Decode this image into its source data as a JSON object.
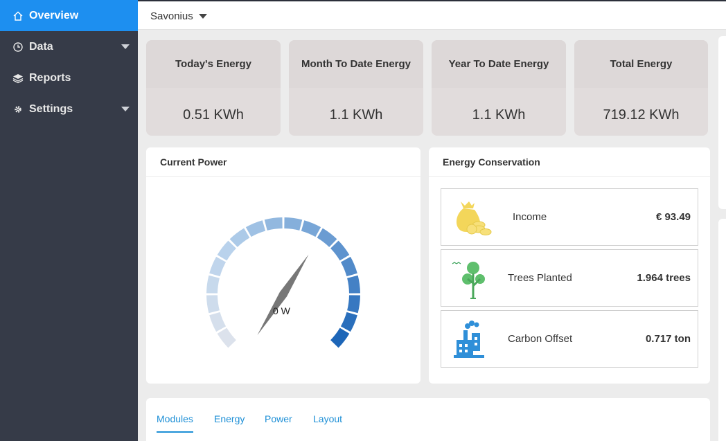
{
  "sidebar": {
    "items": [
      {
        "label": "Overview",
        "icon": "home-icon"
      },
      {
        "label": "Data",
        "icon": "clock-icon"
      },
      {
        "label": "Reports",
        "icon": "layers-icon"
      },
      {
        "label": "Settings",
        "icon": "gear-icon"
      }
    ]
  },
  "topbar": {
    "site": "Savonius"
  },
  "stats": [
    {
      "title": "Today's Energy",
      "value": "0.51 KWh"
    },
    {
      "title": "Month To Date Energy",
      "value": "1.1 KWh"
    },
    {
      "title": "Year To Date Energy",
      "value": "1.1 KWh"
    },
    {
      "title": "Total Energy",
      "value": "719.12 KWh"
    }
  ],
  "current_power": {
    "title": "Current Power",
    "readout": "0 W",
    "value_fraction": 0.62
  },
  "energy_conservation": {
    "title": "Energy Conservation",
    "items": [
      {
        "label": "Income",
        "value": "€ 93.49",
        "icon": "money-bag-icon"
      },
      {
        "label": "Trees Planted",
        "value": "1.964 trees",
        "icon": "tree-icon"
      },
      {
        "label": "Carbon Offset",
        "value": "0.717 ton",
        "icon": "factory-icon"
      }
    ]
  },
  "tabs": [
    "Modules",
    "Energy",
    "Power",
    "Layout"
  ],
  "colors": {
    "accent": "#1d8ff0",
    "sidebar_bg": "#363b48",
    "gauge_light": "#b8d2ec",
    "gauge_dark": "#1d66b8"
  }
}
